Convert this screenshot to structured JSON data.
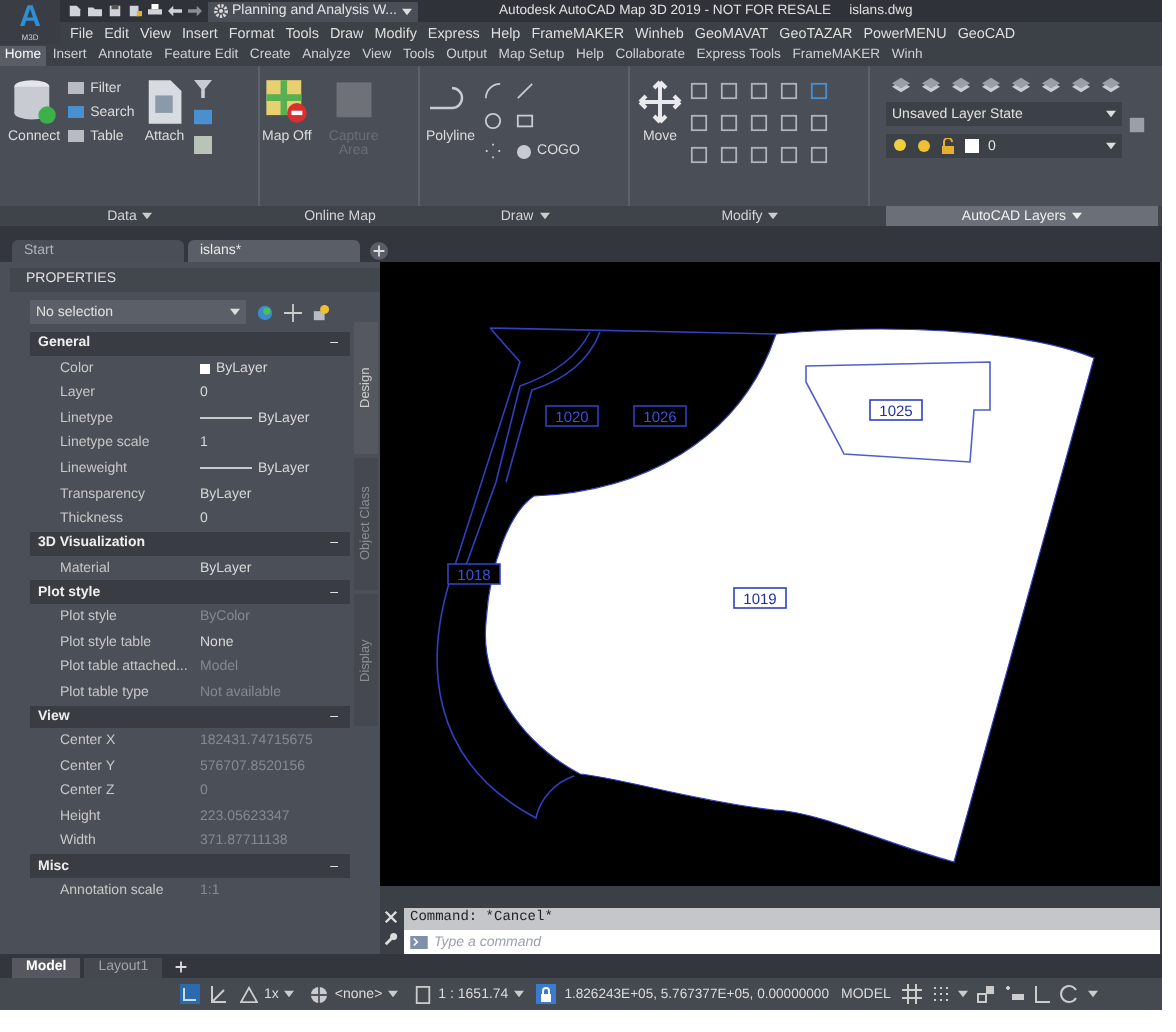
{
  "app_logo": {
    "letter": "A",
    "subtitle": "M3D"
  },
  "workspace": "Planning and Analysis W...",
  "title": "Autodesk AutoCAD Map 3D 2019 - NOT FOR RESALE",
  "file_name": "islans.dwg",
  "menu": [
    "File",
    "Edit",
    "View",
    "Insert",
    "Format",
    "Tools",
    "Draw",
    "Modify",
    "Express",
    "Help",
    "FrameMAKER",
    "Winheb",
    "GeoMAVAT",
    "GeoTAZAR",
    "PowerMENU",
    "GeoCAD"
  ],
  "ribbon_tabs": [
    {
      "label": "Home",
      "selected": true
    },
    {
      "label": "Insert",
      "selected": false
    },
    {
      "label": "Annotate",
      "selected": false
    },
    {
      "label": "Feature Edit",
      "selected": false
    },
    {
      "label": "Create",
      "selected": false
    },
    {
      "label": "Analyze",
      "selected": false
    },
    {
      "label": "View",
      "selected": false
    },
    {
      "label": "Tools",
      "selected": false
    },
    {
      "label": "Output",
      "selected": false
    },
    {
      "label": "Map Setup",
      "selected": false
    },
    {
      "label": "Help",
      "selected": false
    },
    {
      "label": "Collaborate",
      "selected": false
    },
    {
      "label": "Express Tools",
      "selected": false
    },
    {
      "label": "FrameMAKER",
      "selected": false
    },
    {
      "label": "Winh",
      "selected": false
    }
  ],
  "ribbon": {
    "data": {
      "title": "Data",
      "connect": "Connect",
      "small_tools": [
        "Filter",
        "Search",
        "Table"
      ],
      "attach": "Attach"
    },
    "online_map": {
      "title": "Online Map",
      "map_off": "Map Off",
      "capture_area": {
        "label": "Capture Area",
        "disabled": true
      }
    },
    "draw": {
      "title": "Draw",
      "polyline": "Polyline",
      "cogo": "COGO"
    },
    "modify": {
      "title": "Modify",
      "move": "Move"
    },
    "layers": {
      "title": "AutoCAD Layers",
      "layer_state": "Unsaved Layer State",
      "current_layer": "0"
    }
  },
  "document_tabs": [
    {
      "label": "Start",
      "selected": false
    },
    {
      "label": "islans*",
      "selected": true
    }
  ],
  "properties": {
    "title": "PROPERTIES",
    "selection": "No selection",
    "sections": [
      {
        "title": "General",
        "toggle": "–",
        "rows": [
          {
            "label": "Color",
            "value": "ByLayer",
            "kind": "color",
            "dimmed": false
          },
          {
            "label": "Layer",
            "value": "0",
            "kind": "text",
            "dimmed": false
          },
          {
            "label": "Linetype",
            "value": "ByLayer",
            "kind": "line",
            "dimmed": false
          },
          {
            "label": "Linetype scale",
            "value": "1",
            "kind": "text",
            "dimmed": false
          },
          {
            "label": "Lineweight",
            "value": "ByLayer",
            "kind": "line",
            "dimmed": false
          },
          {
            "label": "Transparency",
            "value": "ByLayer",
            "kind": "text",
            "dimmed": false
          },
          {
            "label": "Thickness",
            "value": "0",
            "kind": "text",
            "dimmed": false
          }
        ]
      },
      {
        "title": "3D Visualization",
        "toggle": "–",
        "rows": [
          {
            "label": "Material",
            "value": "ByLayer",
            "kind": "text",
            "dimmed": false
          }
        ]
      },
      {
        "title": "Plot style",
        "toggle": "–",
        "rows": [
          {
            "label": "Plot style",
            "value": "ByColor",
            "kind": "text",
            "dimmed": true
          },
          {
            "label": "Plot style table",
            "value": "None",
            "kind": "text",
            "dimmed": false
          },
          {
            "label": "Plot table attached...",
            "value": "Model",
            "kind": "text",
            "dimmed": true
          },
          {
            "label": "Plot table type",
            "value": "Not available",
            "kind": "text",
            "dimmed": true
          }
        ]
      },
      {
        "title": "View",
        "toggle": "–",
        "rows": [
          {
            "label": "Center X",
            "value": "182431.74715675",
            "kind": "text",
            "dimmed": true
          },
          {
            "label": "Center Y",
            "value": "576707.8520156",
            "kind": "text",
            "dimmed": true
          },
          {
            "label": "Center Z",
            "value": "0",
            "kind": "text",
            "dimmed": true
          },
          {
            "label": "Height",
            "value": "223.05623347",
            "kind": "text",
            "dimmed": true
          },
          {
            "label": "Width",
            "value": "371.87711138",
            "kind": "text",
            "dimmed": true
          }
        ]
      },
      {
        "title": "Misc",
        "toggle": "–",
        "rows": [
          {
            "label": "Annotation scale",
            "value": "1:1",
            "kind": "text",
            "dimmed": true
          }
        ]
      }
    ],
    "side_tabs": [
      {
        "label": "Design",
        "selected": true
      },
      {
        "label": "Object Class",
        "selected": false
      },
      {
        "label": "Display",
        "selected": false
      }
    ]
  },
  "drawing": {
    "parcel_labels": [
      "1020",
      "1026",
      "1025",
      "1018",
      "1019"
    ]
  },
  "command_line": {
    "history": "Command: *Cancel*",
    "placeholder": "Type a command"
  },
  "layout_tabs": [
    {
      "label": "Model",
      "selected": true
    },
    {
      "label": "Layout1",
      "selected": false
    }
  ],
  "status_bar": {
    "annotation_scale": "1x",
    "coordinate_system": "<none>",
    "viewport_scale": "1 : 1651.74",
    "coordinates": "1.826243E+05, 5.767377E+05, 0.00000000",
    "space": "MODEL"
  }
}
